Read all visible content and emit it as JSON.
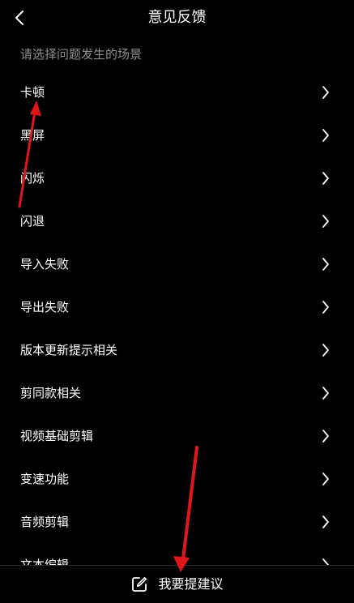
{
  "header": {
    "title": "意见反馈",
    "back_icon": "chevron-left-icon"
  },
  "subtitle": "请选择问题发生的场景",
  "items": [
    {
      "label": "卡顿"
    },
    {
      "label": "黑屏"
    },
    {
      "label": "闪烁"
    },
    {
      "label": "闪退"
    },
    {
      "label": "导入失败"
    },
    {
      "label": "导出失败"
    },
    {
      "label": "版本更新提示相关"
    },
    {
      "label": "剪同款相关"
    },
    {
      "label": "视频基础剪辑"
    },
    {
      "label": "变速功能"
    },
    {
      "label": "音频剪辑"
    },
    {
      "label": "文本编辑"
    }
  ],
  "bottom": {
    "suggest_label": "我要提建议",
    "icon": "edit-icon"
  },
  "colors": {
    "background": "#000000",
    "text": "#ffffff",
    "subtitle": "#8f8f8f",
    "annotation_arrow": "#e0161b"
  }
}
